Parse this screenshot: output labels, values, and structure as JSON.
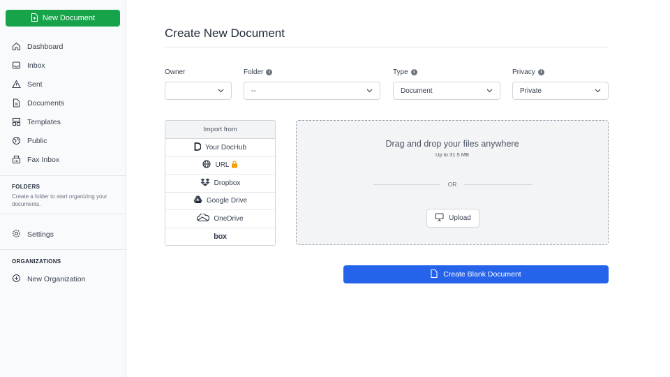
{
  "sidebar": {
    "new_document_label": "New Document",
    "nav": [
      {
        "label": "Dashboard",
        "icon": "home-icon"
      },
      {
        "label": "Inbox",
        "icon": "inbox-icon"
      },
      {
        "label": "Sent",
        "icon": "sent-icon"
      },
      {
        "label": "Documents",
        "icon": "document-icon"
      },
      {
        "label": "Templates",
        "icon": "templates-icon"
      },
      {
        "label": "Public",
        "icon": "globe-icon"
      },
      {
        "label": "Fax Inbox",
        "icon": "fax-icon"
      }
    ],
    "folders_title": "FOLDERS",
    "folders_hint": "Create a folder to start organizing your documents.",
    "settings_label": "Settings",
    "organizations_title": "ORGANIZATIONS",
    "new_organization_label": "New Organization"
  },
  "main": {
    "title": "Create New Document",
    "fields": {
      "owner": {
        "label": "Owner",
        "value": ""
      },
      "folder": {
        "label": "Folder",
        "value": "--"
      },
      "type": {
        "label": "Type",
        "value": "Document"
      },
      "privacy": {
        "label": "Privacy",
        "value": "Private"
      }
    },
    "import": {
      "heading": "Import from",
      "sources": [
        {
          "label": "Your DocHub",
          "icon": "dochub-icon"
        },
        {
          "label": "URL",
          "icon": "globe-icon",
          "locked": true
        },
        {
          "label": "Dropbox",
          "icon": "dropbox-icon"
        },
        {
          "label": "Google Drive",
          "icon": "google-drive-icon"
        },
        {
          "label": "OneDrive",
          "icon": "onedrive-icon"
        },
        {
          "label": "",
          "icon": "box-icon",
          "logo_text": "box"
        }
      ]
    },
    "dropzone": {
      "title": "Drag and drop your files anywhere",
      "subtitle": "Up to 31.5 MB",
      "or_label": "OR",
      "upload_label": "Upload"
    },
    "create_blank_label": "Create Blank Document"
  },
  "colors": {
    "primary_green": "#16a34a",
    "primary_blue": "#2563eb",
    "lock": "#f59e0b"
  }
}
